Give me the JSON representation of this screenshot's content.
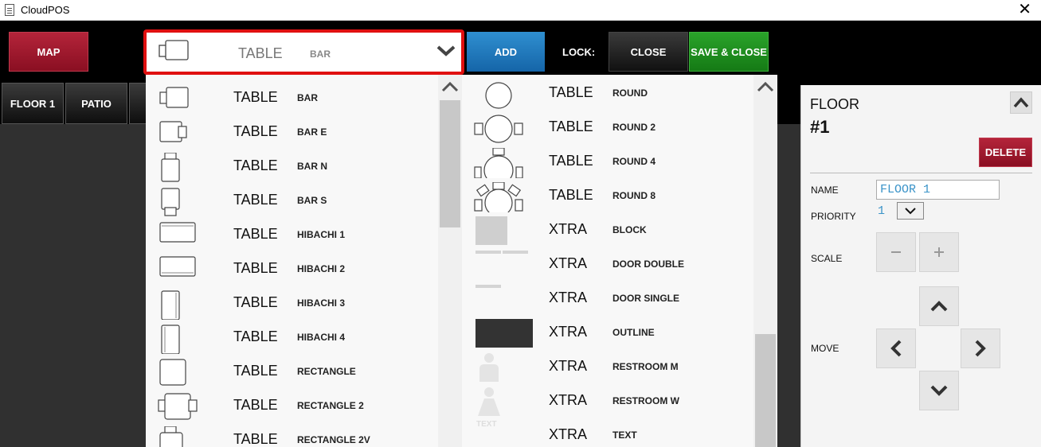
{
  "window": {
    "title": "CloudPOS",
    "close_glyph": "✕"
  },
  "toolbar": {
    "map_label": "MAP",
    "add_label": "ADD",
    "lock_label": "LOCK:",
    "close_label": "CLOSE",
    "save_close_label": "SAVE & CLOSE",
    "colors": {
      "map": "#9c1a2e",
      "add": "#1f78bd",
      "save_close": "#1f8f1f",
      "close": "#1e1e1e",
      "highlight": "#e01010"
    }
  },
  "selector": {
    "kind": "TABLE",
    "name": "BAR",
    "icon": "bar-table-icon"
  },
  "tabs": [
    {
      "label": "FLOOR 1"
    },
    {
      "label": "PATIO"
    }
  ],
  "left_list": [
    {
      "kind": "TABLE",
      "name": "BAR",
      "icon": "bar"
    },
    {
      "kind": "TABLE",
      "name": "BAR E",
      "icon": "bar-e"
    },
    {
      "kind": "TABLE",
      "name": "BAR N",
      "icon": "bar-n"
    },
    {
      "kind": "TABLE",
      "name": "BAR S",
      "icon": "bar-s"
    },
    {
      "kind": "TABLE",
      "name": "HIBACHI 1",
      "icon": "hibachi-1"
    },
    {
      "kind": "TABLE",
      "name": "HIBACHI 2",
      "icon": "hibachi-2"
    },
    {
      "kind": "TABLE",
      "name": "HIBACHI 3",
      "icon": "hibachi-3"
    },
    {
      "kind": "TABLE",
      "name": "HIBACHI 4",
      "icon": "hibachi-4"
    },
    {
      "kind": "TABLE",
      "name": "RECTANGLE",
      "icon": "rectangle"
    },
    {
      "kind": "TABLE",
      "name": "RECTANGLE 2",
      "icon": "rectangle-2"
    },
    {
      "kind": "TABLE",
      "name": "RECTANGLE 2V",
      "icon": "rectangle-2v"
    }
  ],
  "right_list": [
    {
      "kind": "TABLE",
      "name": "ROUND",
      "icon": "round"
    },
    {
      "kind": "TABLE",
      "name": "ROUND 2",
      "icon": "round-2"
    },
    {
      "kind": "TABLE",
      "name": "ROUND 4",
      "icon": "round-4"
    },
    {
      "kind": "TABLE",
      "name": "ROUND 8",
      "icon": "round-8"
    },
    {
      "kind": "XTRA",
      "name": "BLOCK",
      "icon": "block"
    },
    {
      "kind": "XTRA",
      "name": "DOOR DOUBLE",
      "icon": "door-double"
    },
    {
      "kind": "XTRA",
      "name": "DOOR SINGLE",
      "icon": "door-single"
    },
    {
      "kind": "XTRA",
      "name": "OUTLINE",
      "icon": "outline"
    },
    {
      "kind": "XTRA",
      "name": "RESTROOM M",
      "icon": "restroom-m"
    },
    {
      "kind": "XTRA",
      "name": "RESTROOM W",
      "icon": "restroom-w"
    },
    {
      "kind": "XTRA",
      "name": "TEXT",
      "icon": "text",
      "icon_text": "TEXT"
    }
  ],
  "properties": {
    "floor_label": "FLOOR",
    "floor_number": "#1",
    "delete_label": "DELETE",
    "name_label": "NAME",
    "name_value": "FLOOR 1",
    "priority_label": "PRIORITY",
    "priority_value": "1",
    "scale_label": "SCALE",
    "move_label": "MOVE"
  }
}
